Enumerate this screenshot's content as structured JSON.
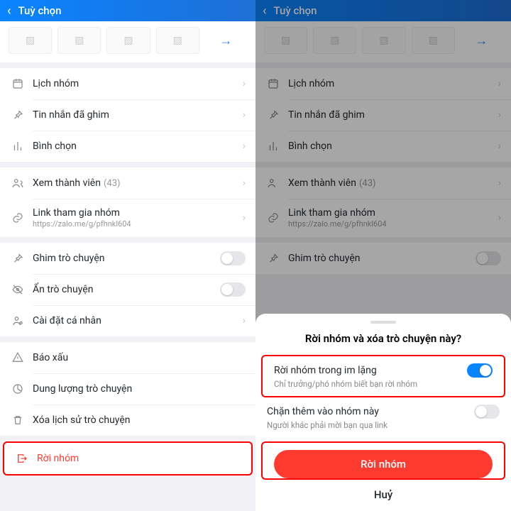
{
  "header": {
    "title": "Tuỳ chọn"
  },
  "menu": {
    "calendar": "Lịch nhóm",
    "pinned": "Tin nhắn đã ghim",
    "poll": "Bình chọn",
    "members": "Xem thành viên",
    "members_count": "(43)",
    "link": "Link tham gia nhóm",
    "link_url": "https://zalo.me/g/pfhnkl604",
    "pin_chat": "Ghim trò chuyện",
    "hide_chat": "Ẩn trò chuyện",
    "personal": "Cài đặt cá nhân",
    "report": "Báo xấu",
    "storage": "Dung lượng trò chuyện",
    "clear": "Xóa lịch sử trò chuyện",
    "leave": "Rời nhóm"
  },
  "sheet": {
    "title": "Rời nhóm và xóa trò chuyện này?",
    "opt1_label": "Rời nhóm trong im lặng",
    "opt1_sub": "Chỉ trưởng/phó nhóm biết bạn rời nhóm",
    "opt2_label": "Chặn thêm vào nhóm này",
    "opt2_sub": "Người khác phải mời bạn qua link",
    "confirm": "Rời nhóm",
    "cancel": "Huỷ"
  }
}
